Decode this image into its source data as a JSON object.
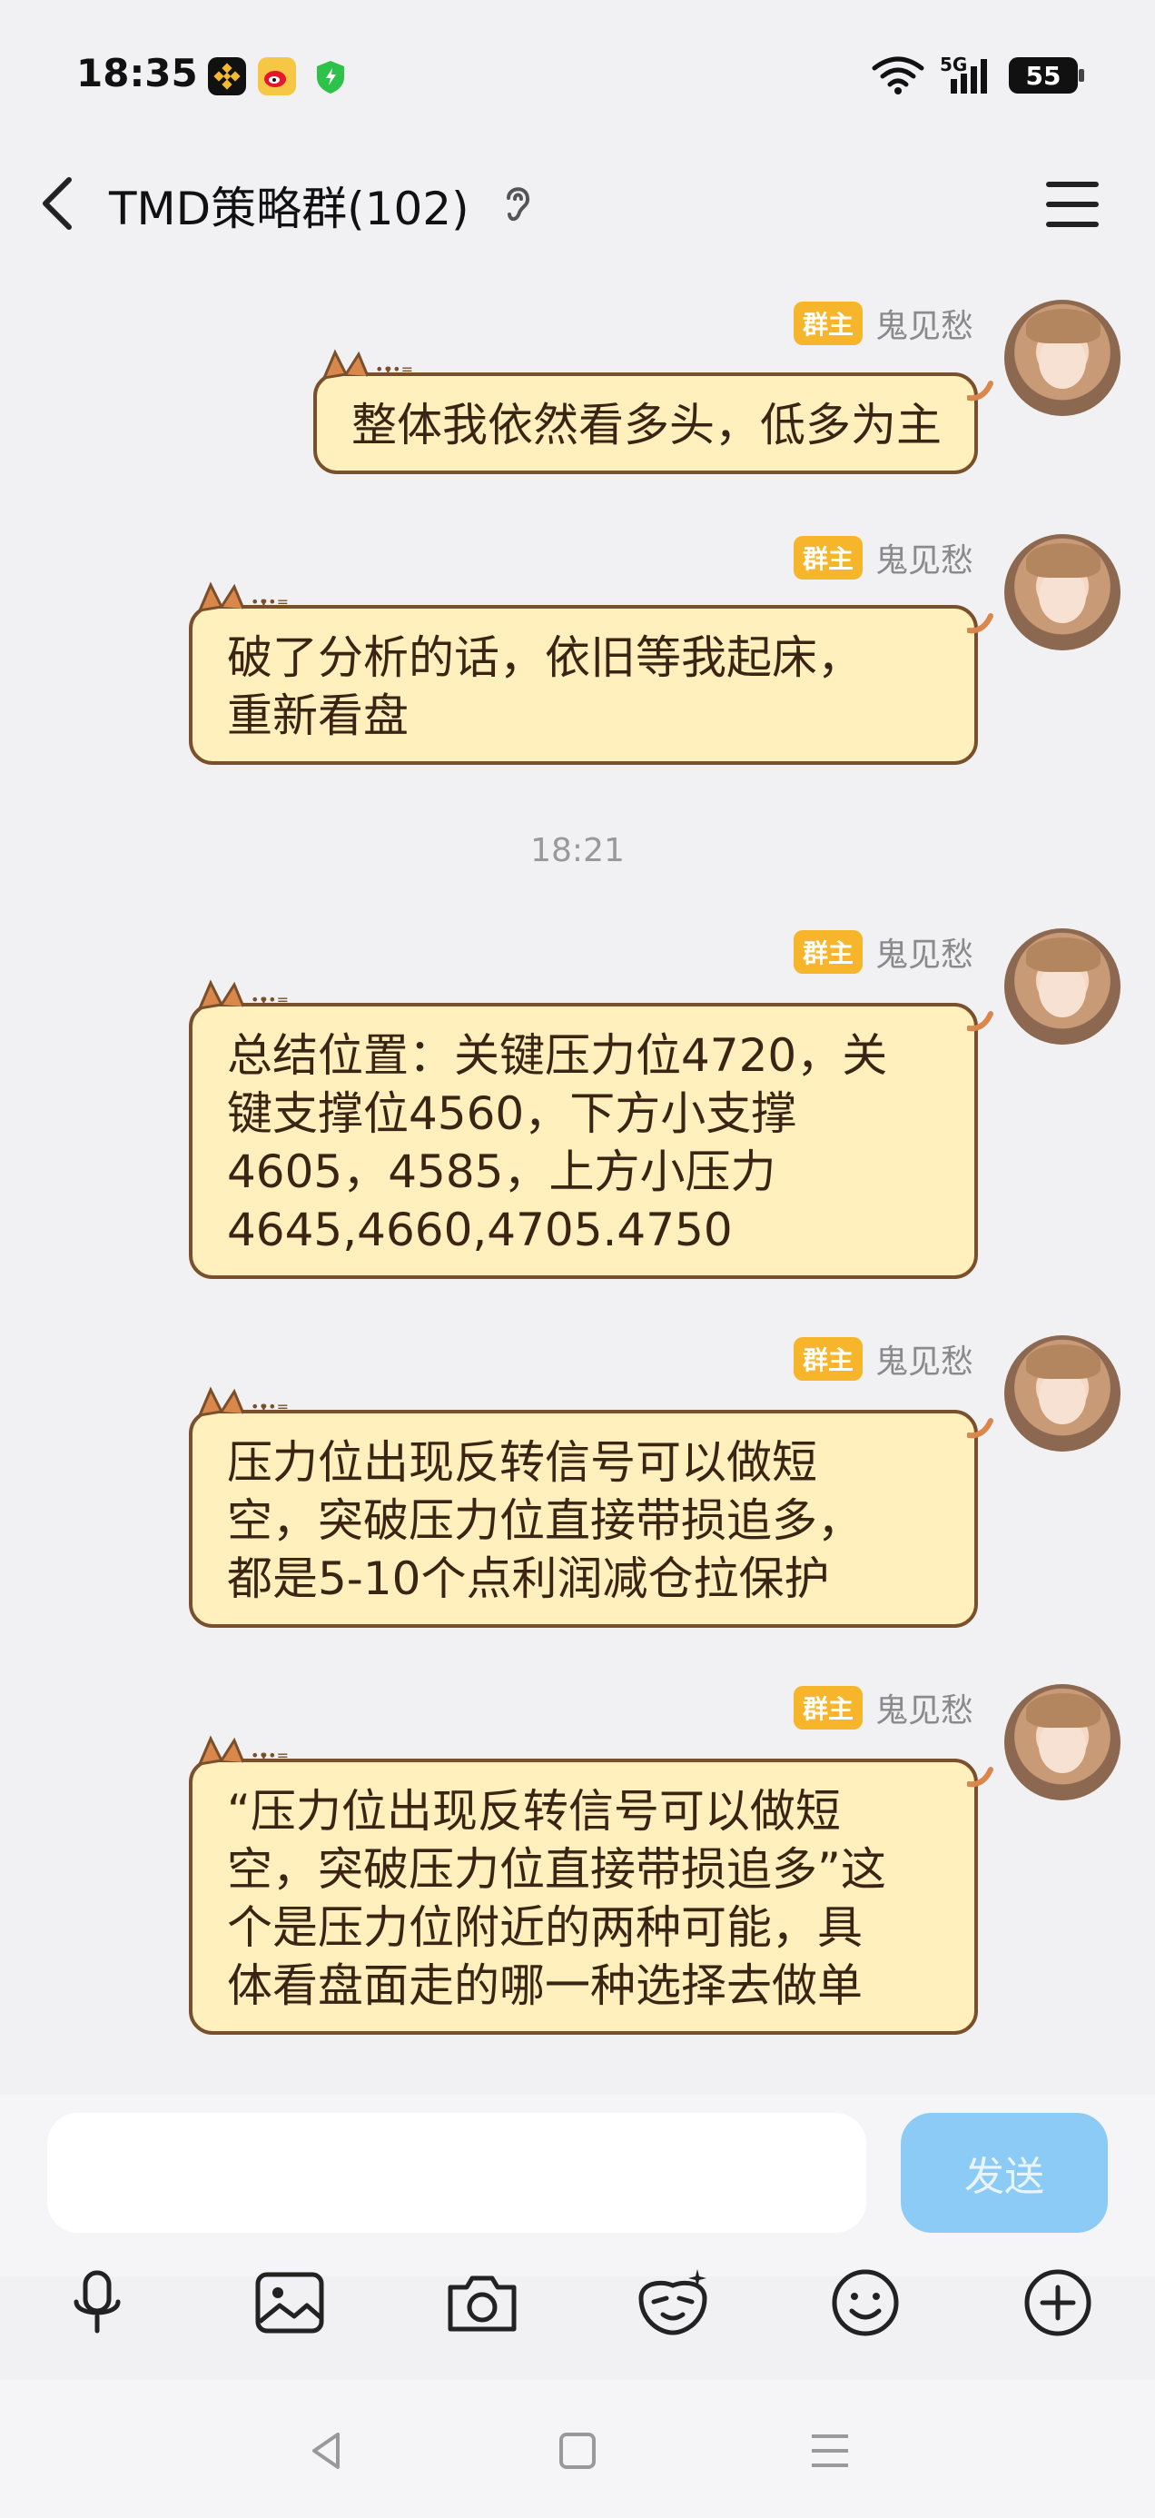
{
  "status_bar": {
    "time": "18:35",
    "network": "5G",
    "battery": "55",
    "app_icons": [
      "binance-icon",
      "weibo-icon",
      "shield-icon"
    ]
  },
  "header": {
    "title": "TMD策略群(102)"
  },
  "messages": [
    {
      "badge": "群主",
      "sender": "鬼见愁",
      "lines": [
        "整体我依然看多头，低多为主"
      ]
    },
    {
      "badge": "群主",
      "sender": "鬼见愁",
      "lines": [
        "破了分析的话，依旧等我起床，",
        "重新看盘"
      ]
    },
    {
      "badge": "群主",
      "sender": "鬼见愁",
      "lines": [
        "总结位置：关键压力位4720，关",
        "键支撑位4560，下方小支撑",
        "4605，4585，上方小压力",
        "4645,4660,4705.4750"
      ]
    },
    {
      "badge": "群主",
      "sender": "鬼见愁",
      "lines": [
        "压力位出现反转信号可以做短",
        "空，突破压力位直接带损追多，",
        "都是5-10个点利润减仓拉保护"
      ]
    },
    {
      "badge": "群主",
      "sender": "鬼见愁",
      "lines": [
        "“压力位出现反转信号可以做短",
        "空，突破压力位直接带损追多”这",
        "个是压力位附近的两种可能，具",
        "体看盘面走的哪一种选择去做单"
      ]
    }
  ],
  "timestamp": "18:21",
  "input": {
    "value": "",
    "send_label": "发送"
  },
  "toolbar": [
    "mic-icon",
    "image-icon",
    "camera-icon",
    "sticker-icon",
    "emoji-icon",
    "plus-icon"
  ],
  "colors": {
    "bubble_bg": "#fff0bd",
    "bubble_border": "#7a4f2c",
    "badge": "#f7b52c",
    "send_button": "#8ccbf6"
  }
}
